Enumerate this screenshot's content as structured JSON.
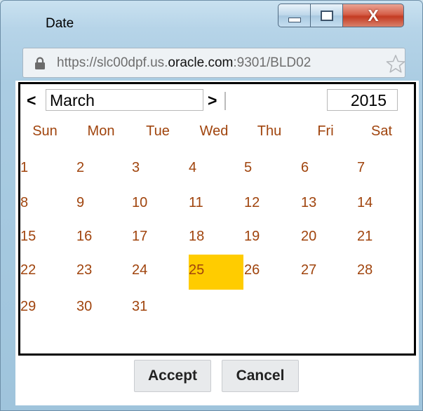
{
  "window": {
    "title": "Date",
    "close_glyph": "X"
  },
  "address_bar": {
    "url_prefix": "https://slc00dpf.us.",
    "url_domain": "oracle.com",
    "url_suffix": ":9301/BLD02",
    "lock_icon": "lock-icon",
    "star_icon": "star-icon"
  },
  "calendar": {
    "prev_label": "<",
    "next_label": ">",
    "month": "March",
    "year": "2015",
    "weekdays": [
      "Sun",
      "Mon",
      "Tue",
      "Wed",
      "Thu",
      "Fri",
      "Sat"
    ],
    "weeks": [
      [
        "1",
        "2",
        "3",
        "4",
        "5",
        "6",
        "7"
      ],
      [
        "8",
        "9",
        "10",
        "11",
        "12",
        "13",
        "14"
      ],
      [
        "15",
        "16",
        "17",
        "18",
        "19",
        "20",
        "21"
      ],
      [
        "22",
        "23",
        "24",
        "25",
        "26",
        "27",
        "28"
      ],
      [
        "29",
        "30",
        "31",
        "",
        "",
        "",
        ""
      ]
    ],
    "selected_day": "25",
    "colors": {
      "day_text": "#a0440d",
      "selected_bg": "#ffcc00"
    }
  },
  "actions": {
    "accept_label": "Accept",
    "cancel_label": "Cancel"
  }
}
